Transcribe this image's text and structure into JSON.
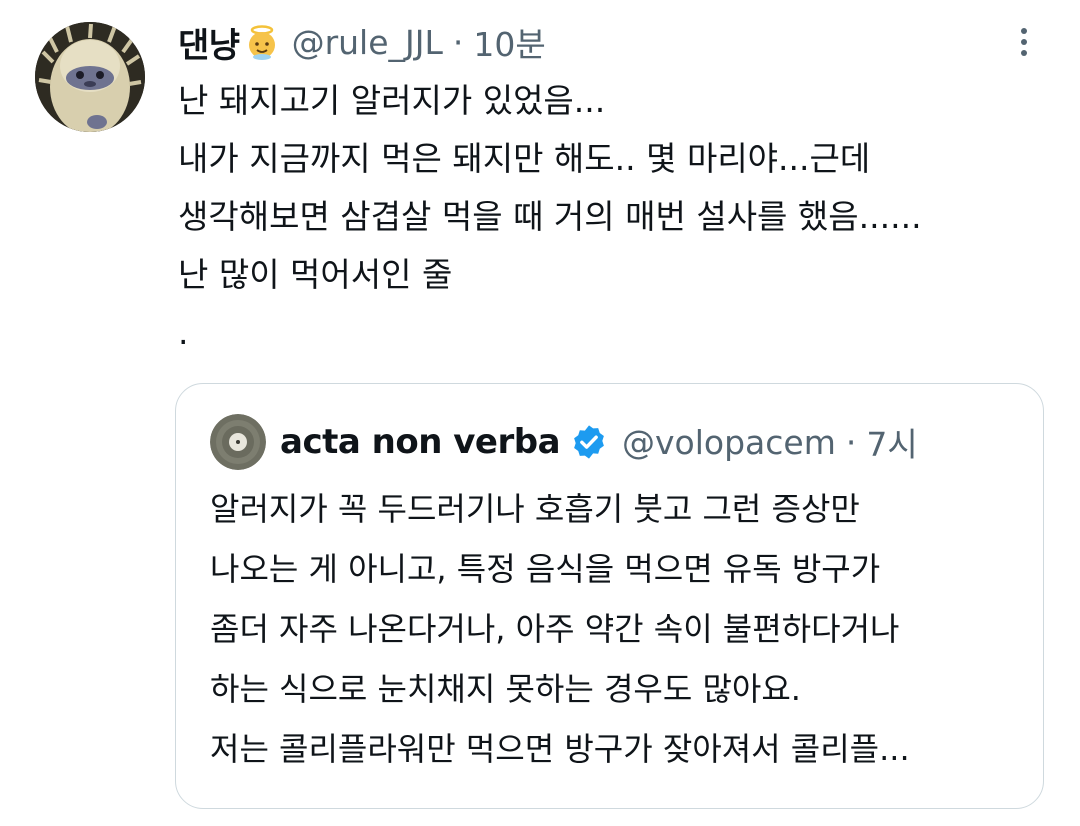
{
  "tweet": {
    "display_name": "댄냥",
    "name_emoji": "baby-angel-emoji",
    "handle": "@rule_JJL",
    "separator": "·",
    "time": "10분",
    "body_lines": [
      "난 돼지고기 알러지가 있었음...",
      "내가 지금까지 먹은 돼지만 해도.. 몇 마리야...근데",
      "생각해보면 삼겹살 먹을 때 거의 매번 설사를 했음......",
      "난 많이 먹어서인 줄",
      "."
    ],
    "more_icon": "more-vertical-icon"
  },
  "quote": {
    "display_name": "acta non verba",
    "verified_icon": "verified-badge-icon",
    "handle": "@volopacem",
    "separator": "·",
    "time": "7시",
    "body_lines": [
      "알러지가 꼭 두드러기나 호흡기 붓고 그런 증상만",
      "나오는 게 아니고, 특정 음식을 먹으면 유독 방구가",
      "좀더 자주 나온다거나, 아주 약간 속이 불편하다거나",
      "하는 식으로 눈치채지 못하는 경우도 많아요.",
      "저는 콜리플라워만 먹으면 방구가 잦아져서 콜리플..."
    ]
  },
  "colors": {
    "text_primary": "#0f1419",
    "text_secondary": "#536471",
    "border": "#cfd9de",
    "verified_blue": "#1d9bf0"
  }
}
